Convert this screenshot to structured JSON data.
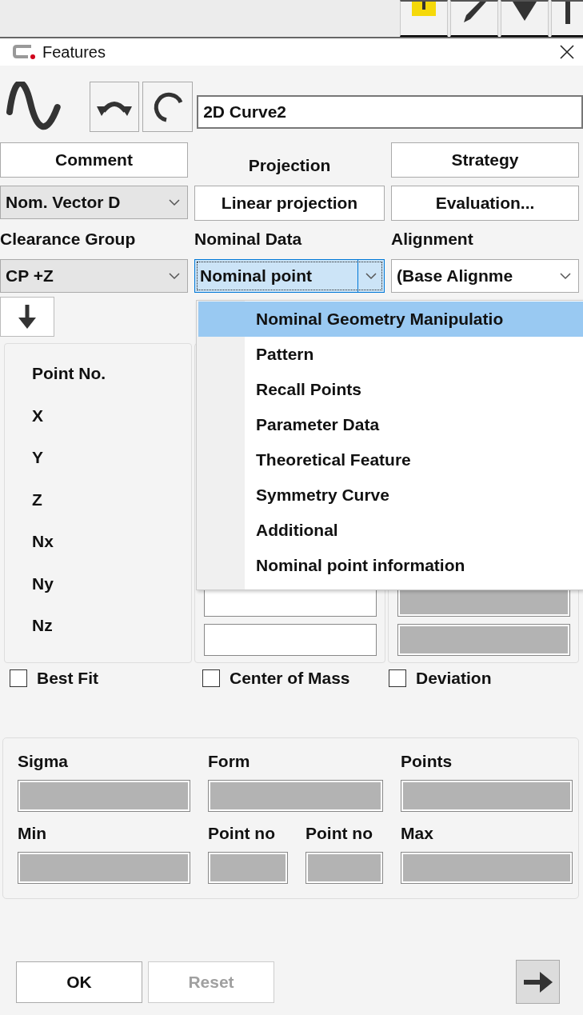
{
  "window": {
    "title": "Features"
  },
  "name_field": {
    "value": "2D Curve2"
  },
  "top_buttons": [
    {
      "label": "Comment",
      "kind": "button"
    },
    {
      "label": "Projection",
      "kind": "label"
    },
    {
      "label": "Strategy",
      "kind": "button"
    }
  ],
  "second_row": [
    {
      "kind": "combo",
      "value": "Nom. Vector D",
      "editable": false
    },
    {
      "kind": "button",
      "label": "Linear projection"
    },
    {
      "kind": "button",
      "label": "Evaluation..."
    }
  ],
  "combo_labels": [
    "Clearance Group",
    "Nominal Data",
    "Alignment"
  ],
  "combos": [
    {
      "value": "CP +Z",
      "editable": false,
      "focused": false
    },
    {
      "value": "Nominal point",
      "editable": true,
      "focused": true
    },
    {
      "value": "(Base Alignme",
      "editable": true,
      "focused": false
    }
  ],
  "dropdown": {
    "items": [
      {
        "label": "Nominal Geometry Manipulatio",
        "selected": true
      },
      {
        "label": "Pattern",
        "selected": false
      },
      {
        "label": "Recall Points",
        "selected": false
      },
      {
        "label": "Parameter Data",
        "selected": false
      },
      {
        "label": "Theoretical Feature",
        "selected": false
      },
      {
        "label": "Symmetry Curve",
        "selected": false
      },
      {
        "label": "Additional",
        "selected": false
      },
      {
        "label": "Nominal point information",
        "selected": false
      }
    ]
  },
  "point_labels": [
    "Point No.",
    "X",
    "Y",
    "Z",
    "Nx",
    "Ny",
    "Nz"
  ],
  "middle_fields": [
    {
      "disabled": false
    },
    {
      "disabled": false
    }
  ],
  "right_fields": [
    {
      "disabled": true
    },
    {
      "disabled": true
    }
  ],
  "checkboxes": [
    {
      "label": "Best Fit",
      "checked": false
    },
    {
      "label": "Center of Mass",
      "checked": false
    },
    {
      "label": "Deviation",
      "checked": false
    }
  ],
  "stats": {
    "fields": [
      {
        "label": "Sigma",
        "kind": "single",
        "disabled": true
      },
      {
        "label": "Form",
        "kind": "double",
        "disabled": true
      },
      {
        "label": "Points",
        "kind": "single",
        "disabled": true
      },
      {
        "label": "Min",
        "kind": "single",
        "disabled": true
      },
      {
        "label": "Point no",
        "kind": "single",
        "disabled": true
      },
      {
        "label": "Point no",
        "kind": "single",
        "disabled": true
      },
      {
        "label": "Max",
        "kind": "single",
        "disabled": true
      }
    ]
  },
  "buttons": [
    {
      "label": "OK",
      "disabled": false
    },
    {
      "label": "Reset",
      "disabled": true
    }
  ]
}
